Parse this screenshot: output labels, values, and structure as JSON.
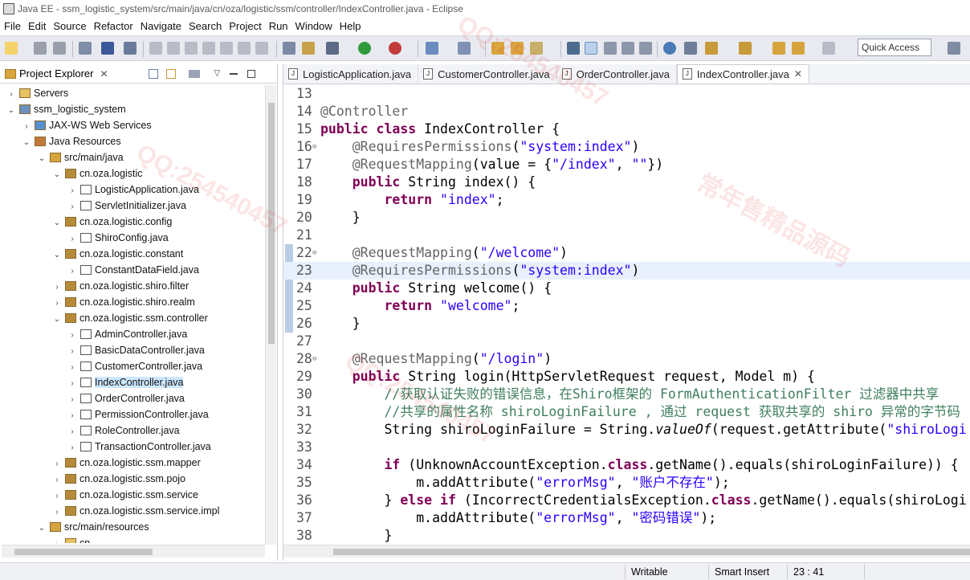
{
  "window": {
    "title": "Java EE - ssm_logistic_system/src/main/java/cn/oza/logistic/ssm/controller/IndexController.java - Eclipse"
  },
  "menu": [
    "File",
    "Edit",
    "Source",
    "Refactor",
    "Navigate",
    "Search",
    "Project",
    "Run",
    "Window",
    "Help"
  ],
  "toolbar": {
    "quick_access": "Quick Access"
  },
  "explorer": {
    "title": "Project Explorer",
    "tree": [
      {
        "label": "Servers",
        "indent": 0,
        "twisty": "›",
        "icon": "folder"
      },
      {
        "label": "ssm_logistic_system",
        "indent": 0,
        "twisty": "⌄",
        "icon": "project"
      },
      {
        "label": "JAX-WS Web Services",
        "indent": 1,
        "twisty": "›",
        "icon": "ws"
      },
      {
        "label": "Java Resources",
        "indent": 1,
        "twisty": "⌄",
        "icon": "jres"
      },
      {
        "label": "src/main/java",
        "indent": 2,
        "twisty": "⌄",
        "icon": "srcfolder"
      },
      {
        "label": "cn.oza.logistic",
        "indent": 3,
        "twisty": "⌄",
        "icon": "package"
      },
      {
        "label": "LogisticApplication.java",
        "indent": 4,
        "twisty": "›",
        "icon": "javafile"
      },
      {
        "label": "ServletInitializer.java",
        "indent": 4,
        "twisty": "›",
        "icon": "javafile"
      },
      {
        "label": "cn.oza.logistic.config",
        "indent": 3,
        "twisty": "⌄",
        "icon": "package"
      },
      {
        "label": "ShiroConfig.java",
        "indent": 4,
        "twisty": "›",
        "icon": "javafile"
      },
      {
        "label": "cn.oza.logistic.constant",
        "indent": 3,
        "twisty": "⌄",
        "icon": "package"
      },
      {
        "label": "ConstantDataField.java",
        "indent": 4,
        "twisty": "›",
        "icon": "javafile"
      },
      {
        "label": "cn.oza.logistic.shiro.filter",
        "indent": 3,
        "twisty": "›",
        "icon": "package"
      },
      {
        "label": "cn.oza.logistic.shiro.realm",
        "indent": 3,
        "twisty": "›",
        "icon": "package"
      },
      {
        "label": "cn.oza.logistic.ssm.controller",
        "indent": 3,
        "twisty": "⌄",
        "icon": "package"
      },
      {
        "label": "AdminController.java",
        "indent": 4,
        "twisty": "›",
        "icon": "javafile"
      },
      {
        "label": "BasicDataController.java",
        "indent": 4,
        "twisty": "›",
        "icon": "javafile"
      },
      {
        "label": "CustomerController.java",
        "indent": 4,
        "twisty": "›",
        "icon": "javafile"
      },
      {
        "label": "IndexController.java",
        "indent": 4,
        "twisty": "›",
        "icon": "javafile",
        "selected": true
      },
      {
        "label": "OrderController.java",
        "indent": 4,
        "twisty": "›",
        "icon": "javafile"
      },
      {
        "label": "PermissionController.java",
        "indent": 4,
        "twisty": "›",
        "icon": "javafile"
      },
      {
        "label": "RoleController.java",
        "indent": 4,
        "twisty": "›",
        "icon": "javafile"
      },
      {
        "label": "TransactionController.java",
        "indent": 4,
        "twisty": "›",
        "icon": "javafile"
      },
      {
        "label": "cn.oza.logistic.ssm.mapper",
        "indent": 3,
        "twisty": "›",
        "icon": "package"
      },
      {
        "label": "cn.oza.logistic.ssm.pojo",
        "indent": 3,
        "twisty": "›",
        "icon": "package"
      },
      {
        "label": "cn.oza.logistic.ssm.service",
        "indent": 3,
        "twisty": "›",
        "icon": "package"
      },
      {
        "label": "cn.oza.logistic.ssm.service.impl",
        "indent": 3,
        "twisty": "›",
        "icon": "package"
      },
      {
        "label": "src/main/resources",
        "indent": 2,
        "twisty": "⌄",
        "icon": "srcfolder"
      },
      {
        "label": "cn",
        "indent": 3,
        "twisty": "›",
        "icon": "folder"
      }
    ]
  },
  "editor": {
    "tabs": [
      {
        "label": "LogisticApplication.java",
        "active": false
      },
      {
        "label": "CustomerController.java",
        "active": false
      },
      {
        "label": "OrderController.java",
        "active": false
      },
      {
        "label": "IndexController.java",
        "active": true
      }
    ],
    "lines": [
      {
        "n": "13",
        "fold": false,
        "cur": false,
        "html": ""
      },
      {
        "n": "14",
        "fold": false,
        "cur": false,
        "html": "<span class='an'>@Controller</span>"
      },
      {
        "n": "15",
        "fold": false,
        "cur": false,
        "html": "<span class='kw'>public class</span> IndexController {"
      },
      {
        "n": "16",
        "fold": true,
        "cur": false,
        "html": "    <span class='an'>@RequiresPermissions</span>(<span class='st'>\"system:index\"</span>)"
      },
      {
        "n": "17",
        "fold": false,
        "cur": false,
        "html": "    <span class='an'>@RequestMapping</span>(value = {<span class='st'>\"/index\"</span>, <span class='st'>\"\"</span>})"
      },
      {
        "n": "18",
        "fold": false,
        "cur": false,
        "html": "    <span class='kw'>public</span> String index() {"
      },
      {
        "n": "19",
        "fold": false,
        "cur": false,
        "html": "        <span class='kw'>return</span> <span class='st'>\"index\"</span>;"
      },
      {
        "n": "20",
        "fold": false,
        "cur": false,
        "html": "    }"
      },
      {
        "n": "21",
        "fold": false,
        "cur": false,
        "html": ""
      },
      {
        "n": "22",
        "fold": true,
        "cur": false,
        "html": "    <span class='an'>@RequestMapping</span>(<span class='st'>\"/welcome\"</span>)"
      },
      {
        "n": "23",
        "fold": false,
        "cur": true,
        "html": "    <span class='an'>@RequiresPermissions</span>(<span class='st'>\"system:index\"</span>)"
      },
      {
        "n": "24",
        "fold": false,
        "cur": false,
        "html": "    <span class='kw'>public</span> String welcome() {"
      },
      {
        "n": "25",
        "fold": false,
        "cur": false,
        "html": "        <span class='kw'>return</span> <span class='st'>\"welcome\"</span>;"
      },
      {
        "n": "26",
        "fold": false,
        "cur": false,
        "html": "    }"
      },
      {
        "n": "27",
        "fold": false,
        "cur": false,
        "html": ""
      },
      {
        "n": "28",
        "fold": true,
        "cur": false,
        "html": "    <span class='an'>@RequestMapping</span>(<span class='st'>\"/login\"</span>)"
      },
      {
        "n": "29",
        "fold": false,
        "cur": false,
        "html": "    <span class='kw'>public</span> String login(HttpServletRequest request, Model m) {"
      },
      {
        "n": "30",
        "fold": false,
        "cur": false,
        "html": "        <span class='cm'>//获取认证失败的错误信息，在Shiro框架的 FormAuthenticationFilter 过滤器中共享</span>"
      },
      {
        "n": "31",
        "fold": false,
        "cur": false,
        "html": "        <span class='cm'>//共享的属性名称 shiroLoginFailure , 通过 request 获取共享的 shiro 异常的字节码</span>"
      },
      {
        "n": "32",
        "fold": false,
        "cur": false,
        "html": "        String shiroLoginFailure = String.<span class='it'>valueOf</span>(request.getAttribute(<span class='st'>\"shiroLogi</span>"
      },
      {
        "n": "33",
        "fold": false,
        "cur": false,
        "html": ""
      },
      {
        "n": "34",
        "fold": false,
        "cur": false,
        "html": "        <span class='kw'>if</span> (UnknownAccountException.<span class='kw'>class</span>.getName().equals(shiroLoginFailure)) {"
      },
      {
        "n": "35",
        "fold": false,
        "cur": false,
        "html": "            m.addAttribute(<span class='st'>\"errorMsg\"</span>, <span class='st'>\"账户不存在\"</span>);"
      },
      {
        "n": "36",
        "fold": false,
        "cur": false,
        "html": "        } <span class='kw'>else if</span> (IncorrectCredentialsException.<span class='kw'>class</span>.getName().equals(shiroLogi"
      },
      {
        "n": "37",
        "fold": false,
        "cur": false,
        "html": "            m.addAttribute(<span class='st'>\"errorMsg\"</span>, <span class='st'>\"密码错误\"</span>);"
      },
      {
        "n": "38",
        "fold": false,
        "cur": false,
        "html": "        }"
      }
    ]
  },
  "status": {
    "mode": "Writable",
    "insert": "Smart Insert",
    "position": "23 : 41"
  }
}
